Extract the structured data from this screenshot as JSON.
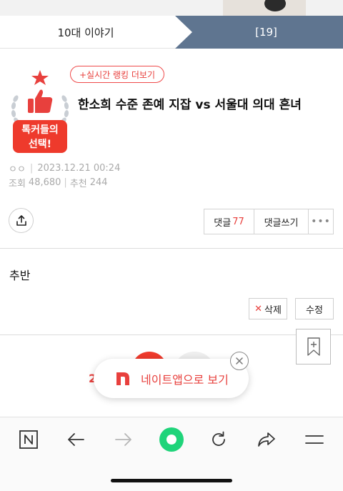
{
  "tabs": {
    "left_label": "10대 이야기",
    "right_label": "[19]"
  },
  "badge": {
    "line1": "톡커들의",
    "line2": "선택!"
  },
  "ranking_link": "+실시간 랭킹 더보기",
  "post": {
    "title": "한소희 수준 존예 지잡 vs 서울대 의대 흔녀",
    "author": "ㅇㅇ",
    "datetime": "2023.12.21 00:24",
    "views_label": "조회",
    "views": "48,680",
    "likes_label": "추천",
    "likes": "244",
    "body": "추반"
  },
  "actions": {
    "comments_label": "댓글",
    "comments_count": "77",
    "write_comment": "댓글쓰기",
    "more": "•••"
  },
  "post_buttons": {
    "delete_mark": "✕",
    "delete": "삭제",
    "edit": "수정"
  },
  "reaction": {
    "count_partial": "2"
  },
  "app_popup": {
    "label": "네이트앱으로 보기"
  },
  "colors": {
    "accent_red": "#e8403d",
    "tab_blue": "#5f7590",
    "app_green": "#1fd47a"
  },
  "browser_nav": {
    "icons": [
      "nate-n-icon",
      "back-arrow-icon",
      "forward-arrow-icon",
      "home-circle-icon",
      "reload-icon",
      "share-icon",
      "menu-icon"
    ]
  }
}
